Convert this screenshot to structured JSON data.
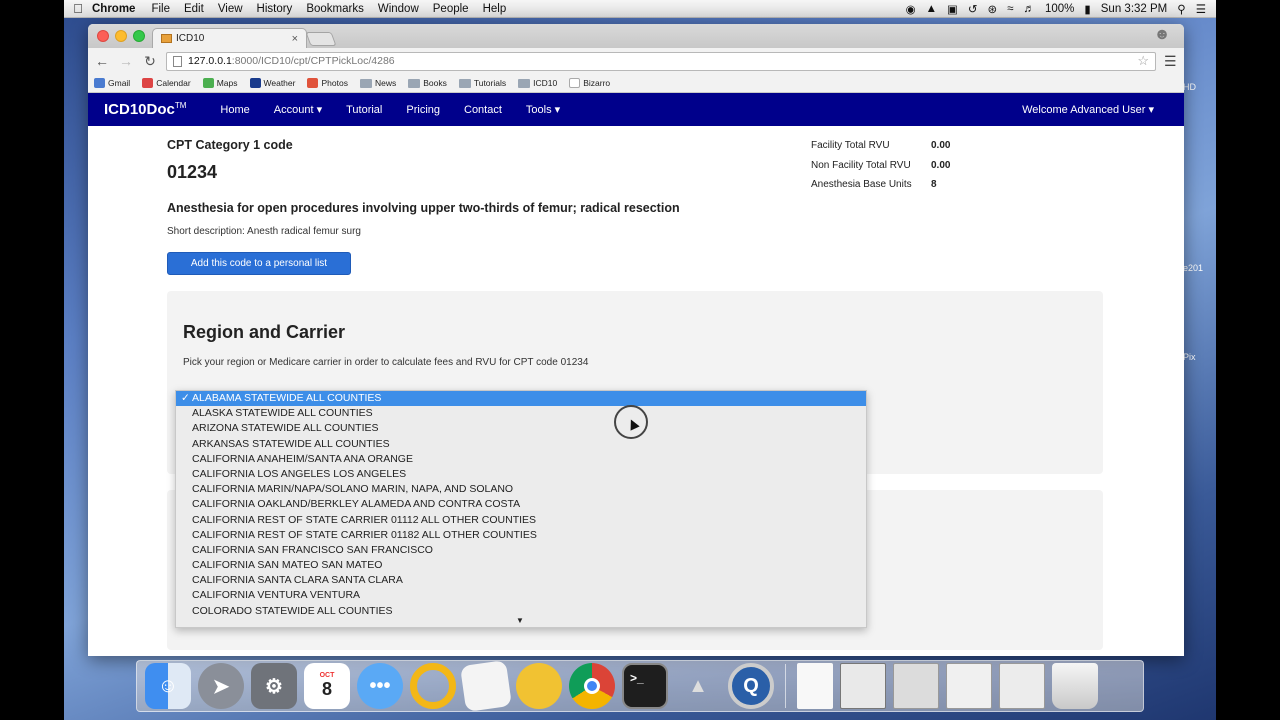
{
  "menubar": {
    "app": "Chrome",
    "items": [
      "File",
      "Edit",
      "View",
      "History",
      "Bookmarks",
      "Window",
      "People",
      "Help"
    ],
    "battery": "100%",
    "clock": "Sun 3:32 PM"
  },
  "desktop": {
    "frag1": "HD",
    "frag2": "e201",
    "frag3": "Pix"
  },
  "browser": {
    "tab_title": "ICD10",
    "url_host": "127.0.0.1",
    "url_path": ":8000/ICD10/cpt/CPTPickLoc/4286",
    "bookmarks": [
      "Gmail",
      "Calendar",
      "Maps",
      "Weather",
      "Photos",
      "News",
      "Books",
      "Tutorials",
      "ICD10",
      "Bizarro"
    ]
  },
  "site": {
    "brand": "ICD10Doc",
    "brand_tm": "TM",
    "nav": [
      "Home",
      "Account ▾",
      "Tutorial",
      "Pricing",
      "Contact",
      "Tools ▾"
    ],
    "welcome": "Welcome Advanced User ▾"
  },
  "code": {
    "category": "CPT Category 1 code",
    "number": "01234",
    "long_description": "Anesthesia for open procedures involving upper two-thirds of femur; radical resection",
    "short_description": "Short description: Anesth radical femur surg",
    "add_button": "Add this code to a personal list"
  },
  "rvu": [
    {
      "label": "Facility Total RVU",
      "value": "0.00"
    },
    {
      "label": "Non Facility Total RVU",
      "value": "0.00"
    },
    {
      "label": "Anesthesia Base Units",
      "value": "8"
    }
  ],
  "region": {
    "title": "Region and Carrier",
    "description": "Pick your region or Medicare carrier in order to calculate fees and RVU for CPT code 01234",
    "options": [
      "ALABAMA STATEWIDE ALL COUNTIES",
      "ALASKA STATEWIDE ALL COUNTIES",
      "ARIZONA STATEWIDE ALL COUNTIES",
      "ARKANSAS STATEWIDE ALL COUNTIES",
      "CALIFORNIA ANAHEIM/SANTA ANA ORANGE",
      "CALIFORNIA LOS ANGELES LOS ANGELES",
      "CALIFORNIA MARIN/NAPA/SOLANO MARIN, NAPA, AND SOLANO",
      "CALIFORNIA OAKLAND/BERKLEY ALAMEDA AND CONTRA COSTA",
      "CALIFORNIA REST OF STATE CARRIER 01112 ALL OTHER COUNTIES",
      "CALIFORNIA REST OF STATE CARRIER 01182 ALL OTHER COUNTIES",
      "CALIFORNIA SAN FRANCISCO SAN FRANCISCO",
      "CALIFORNIA SAN MATEO SAN MATEO",
      "CALIFORNIA SANTA CLARA SANTA CLARA",
      "CALIFORNIA VENTURA VENTURA",
      "COLORADO STATEWIDE ALL COUNTIES"
    ],
    "selected_index": 0
  },
  "dock": {
    "calendar_month": "OCT",
    "calendar_day": "8",
    "apps": [
      "finder-icon",
      "launchpad-icon",
      "system-preferences-icon",
      "calendar-icon",
      "messages-icon",
      "outlook-icon",
      "textedit-icon",
      "migration-icon",
      "chrome-icon",
      "terminal-icon",
      "rocket-icon",
      "quicktime-icon"
    ]
  }
}
